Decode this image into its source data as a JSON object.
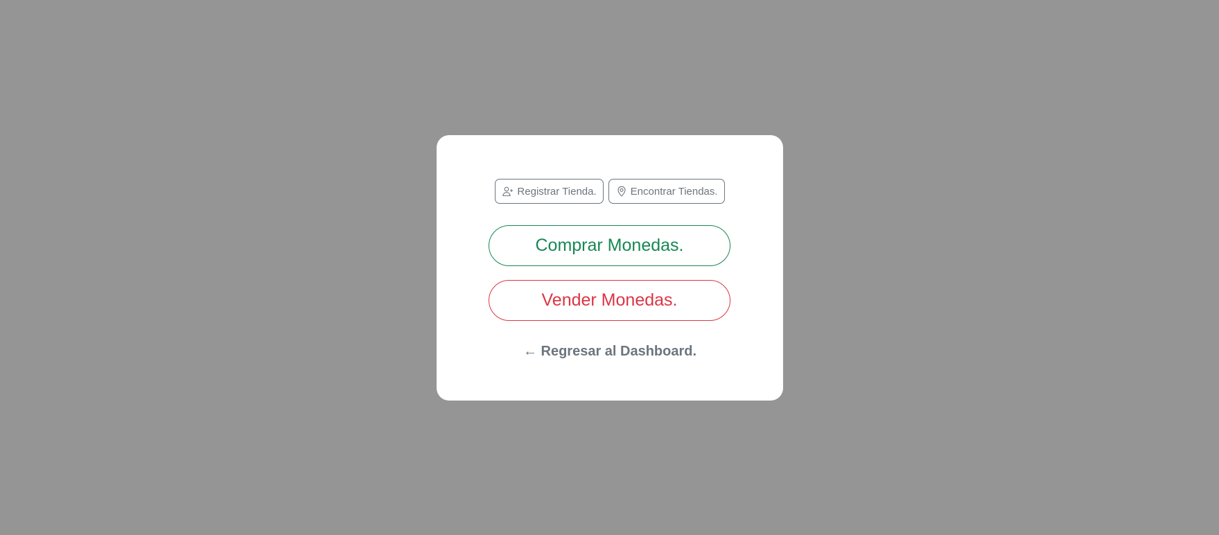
{
  "actions": {
    "register_store_label": "Registrar Tienda.",
    "register_store_icon": "person-add-icon",
    "find_stores_label": "Encontrar Tiendas.",
    "find_stores_icon": "map-pin-icon"
  },
  "main": {
    "buy_label": "Comprar Monedas.",
    "sell_label": "Vender Monedas.",
    "back_label": "← Regresar al Dashboard."
  },
  "colors": {
    "backdrop": "#959595",
    "buy": "#198754",
    "sell": "#dc3545",
    "secondary": "#6c757d"
  }
}
